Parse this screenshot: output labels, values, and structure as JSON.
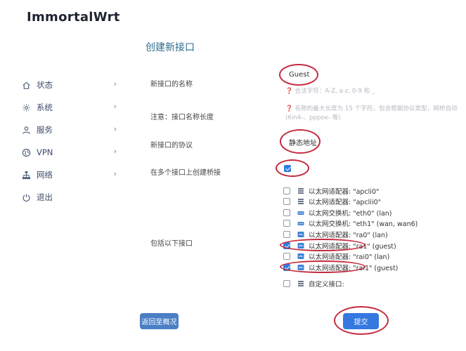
{
  "brand": "ImmortalWrt",
  "sidebar": {
    "items": [
      {
        "label": "状态",
        "icon": "home-icon"
      },
      {
        "label": "系统",
        "icon": "gear-icon"
      },
      {
        "label": "服务",
        "icon": "user-icon"
      },
      {
        "label": "VPN",
        "icon": "globe-icon"
      },
      {
        "label": "网络",
        "icon": "network-icon"
      },
      {
        "label": "退出",
        "icon": "power-icon"
      }
    ]
  },
  "form": {
    "title": "创建新接口",
    "name_label": "新接口的名称",
    "name_value": "Guest",
    "name_hint": "合法字符：A-Z, a-z, 0-9 和 _",
    "note_label": "注意：接口名称长度",
    "note_hint": "名称的最大长度为 15 个字符，包含根据协议类型，网桥自动 (6in4-、pppoe- 等)",
    "protocol_label": "新接口的协议",
    "protocol_value": "静态地址",
    "bridge_label": "在多个接口上创建桥接",
    "bridge_checked": true,
    "include_label": "包括以下接口",
    "interfaces": [
      {
        "label": "以太网适配器: \"apcli0\"",
        "checked": false,
        "icon": "ethernet-icon"
      },
      {
        "label": "以太网适配器: \"apclii0\"",
        "checked": false,
        "icon": "ethernet-icon"
      },
      {
        "label": "以太网交换机: \"eth0\" (lan)",
        "checked": false,
        "icon": "switch-icon"
      },
      {
        "label": "以太网交换机: \"eth1\" (wan, wan6)",
        "checked": false,
        "icon": "switch-icon"
      },
      {
        "label": "以太网适配器: \"ra0\" (lan)",
        "checked": false,
        "icon": "wireless-icon"
      },
      {
        "label": "以太网适配器: \"ra1\" (guest)",
        "checked": true,
        "icon": "wireless-icon"
      },
      {
        "label": "以太网适配器: \"rai0\" (lan)",
        "checked": false,
        "icon": "wireless-icon"
      },
      {
        "label": "以太网适配器: \"rai1\" (guest)",
        "checked": true,
        "icon": "wireless-icon"
      },
      {
        "label": "自定义接口:",
        "checked": false,
        "icon": "ethernet-icon"
      }
    ],
    "back_button": "返回至概况",
    "submit_button": "提交"
  },
  "colors": {
    "accent": "#3478e0",
    "title": "#2f6d8e",
    "annotation": "#c42b3f"
  }
}
